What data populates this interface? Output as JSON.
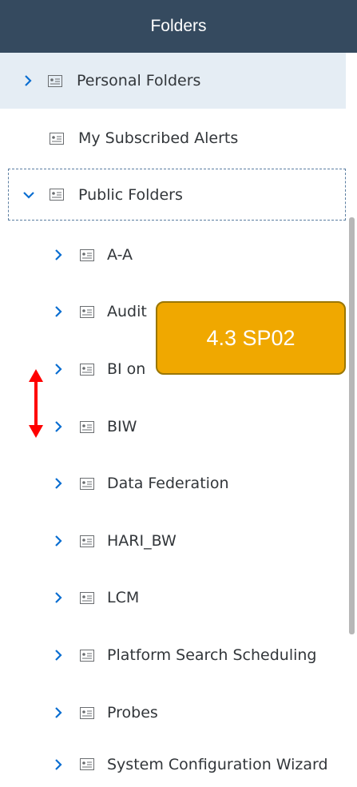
{
  "header": {
    "title": "Folders"
  },
  "tree": {
    "personal": "Personal Folders",
    "subscribed": "My Subscribed Alerts",
    "public": "Public Folders",
    "children": [
      "A-A",
      "Audit",
      "BI on",
      "BIW",
      "Data Federation",
      "HARI_BW",
      "LCM",
      "Platform Search Scheduling",
      "Probes",
      "System Configuration Wizard"
    ]
  },
  "overlay": {
    "version": "4.3 SP02"
  },
  "colors": {
    "header": "#354a5f",
    "selected": "#e5edf4",
    "badge": "#f0a800",
    "arrow": "#ff0000",
    "chevron": "#0a6ed1"
  },
  "icons": {
    "chevron": "chevron-right-icon",
    "expanded": "chevron-down-icon",
    "folder": "folder-card-icon",
    "arrow": "double-arrow-icon"
  }
}
